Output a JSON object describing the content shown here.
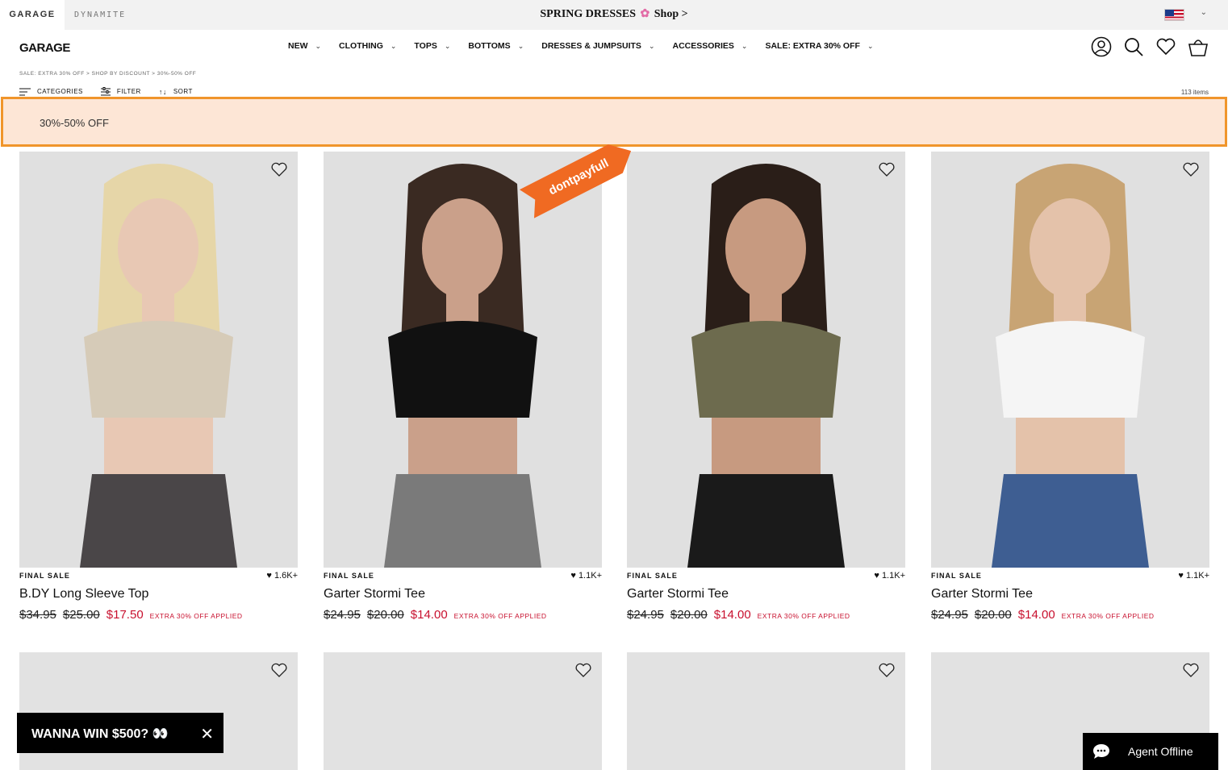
{
  "topbar": {
    "brands": [
      "GARAGE",
      "DYNAMITE"
    ],
    "promo_text": "SPRING DRESSES",
    "promo_link": "Shop >"
  },
  "header": {
    "logo": "GARAGE",
    "nav": [
      "NEW",
      "CLOTHING",
      "TOPS",
      "BOTTOMS",
      "DRESSES & JUMPSUITS",
      "ACCESSORIES",
      "SALE: EXTRA 30% OFF"
    ]
  },
  "breadcrumb": "SALE: EXTRA 30% OFF > SHOP BY DISCOUNT > 30%-50% OFF",
  "filters": {
    "categories": "CATEGORIES",
    "filter": "FILTER",
    "sort": "SORT"
  },
  "item_count": "113 items",
  "banner": "30%-50% OFF",
  "products": [
    {
      "badge": "FINAL SALE",
      "likes": "1.6K+",
      "name": "B.DY Long Sleeve Top",
      "price_orig": "$34.95",
      "price_prev": "$25.00",
      "price_sale": "$17.50",
      "applied": "EXTRA 30% OFF APPLIED",
      "top_color": "#d6cbb8",
      "bottom_color": "#4a4648",
      "skin": "#e8c8b4",
      "hair": "#e6d6a8"
    },
    {
      "badge": "FINAL SALE",
      "likes": "1.1K+",
      "name": "Garter Stormi Tee",
      "price_orig": "$24.95",
      "price_prev": "$20.00",
      "price_sale": "$14.00",
      "applied": "EXTRA 30% OFF APPLIED",
      "top_color": "#111111",
      "bottom_color": "#7a7a7a",
      "skin": "#caa08a",
      "hair": "#3a2a22"
    },
    {
      "badge": "FINAL SALE",
      "likes": "1.1K+",
      "name": "Garter Stormi Tee",
      "price_orig": "$24.95",
      "price_prev": "$20.00",
      "price_sale": "$14.00",
      "applied": "EXTRA 30% OFF APPLIED",
      "top_color": "#6d6b4e",
      "bottom_color": "#1a1a1a",
      "skin": "#c79a80",
      "hair": "#2a1e18"
    },
    {
      "badge": "FINAL SALE",
      "likes": "1.1K+",
      "name": "Garter Stormi Tee",
      "price_orig": "$24.95",
      "price_prev": "$20.00",
      "price_sale": "$14.00",
      "applied": "EXTRA 30% OFF APPLIED",
      "top_color": "#f5f5f5",
      "bottom_color": "#3e5e92",
      "skin": "#e4c2aa",
      "hair": "#c8a474"
    }
  ],
  "popup": {
    "text": "WANNA WIN $500?"
  },
  "chat": {
    "label": "Agent Offline"
  },
  "watermark": "dontpayfull"
}
